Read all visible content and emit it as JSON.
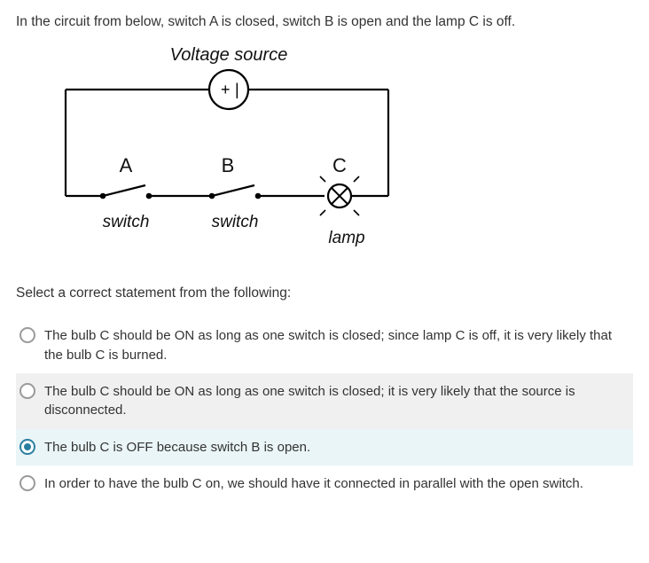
{
  "question": "In the circuit from below, switch A is closed, switch B is open and the lamp C is off.",
  "circuit": {
    "voltage_source_label": "Voltage source",
    "voltage_source_symbol_plus": "+",
    "voltage_source_symbol_minus": "|",
    "labelA": "A",
    "labelB": "B",
    "labelC": "C",
    "switch_label_A": "switch",
    "switch_label_B": "switch",
    "lamp_label": "lamp"
  },
  "prompt": "Select a correct statement from the following:",
  "options": [
    {
      "text": "The bulb C should be ON as long as one switch is closed; since lamp C is off, it is very likely that the bulb C is burned.",
      "selected": false,
      "highlight": "none"
    },
    {
      "text": "The bulb C should be ON as long as one switch is closed; it is very likely that the source is disconnected.",
      "selected": false,
      "highlight": "hover"
    },
    {
      "text": "The bulb C is OFF because switch B is open.",
      "selected": true,
      "highlight": "selected"
    },
    {
      "text": "In order to have the bulb C on, we should have it connected in parallel with the open switch.",
      "selected": false,
      "highlight": "none"
    }
  ]
}
